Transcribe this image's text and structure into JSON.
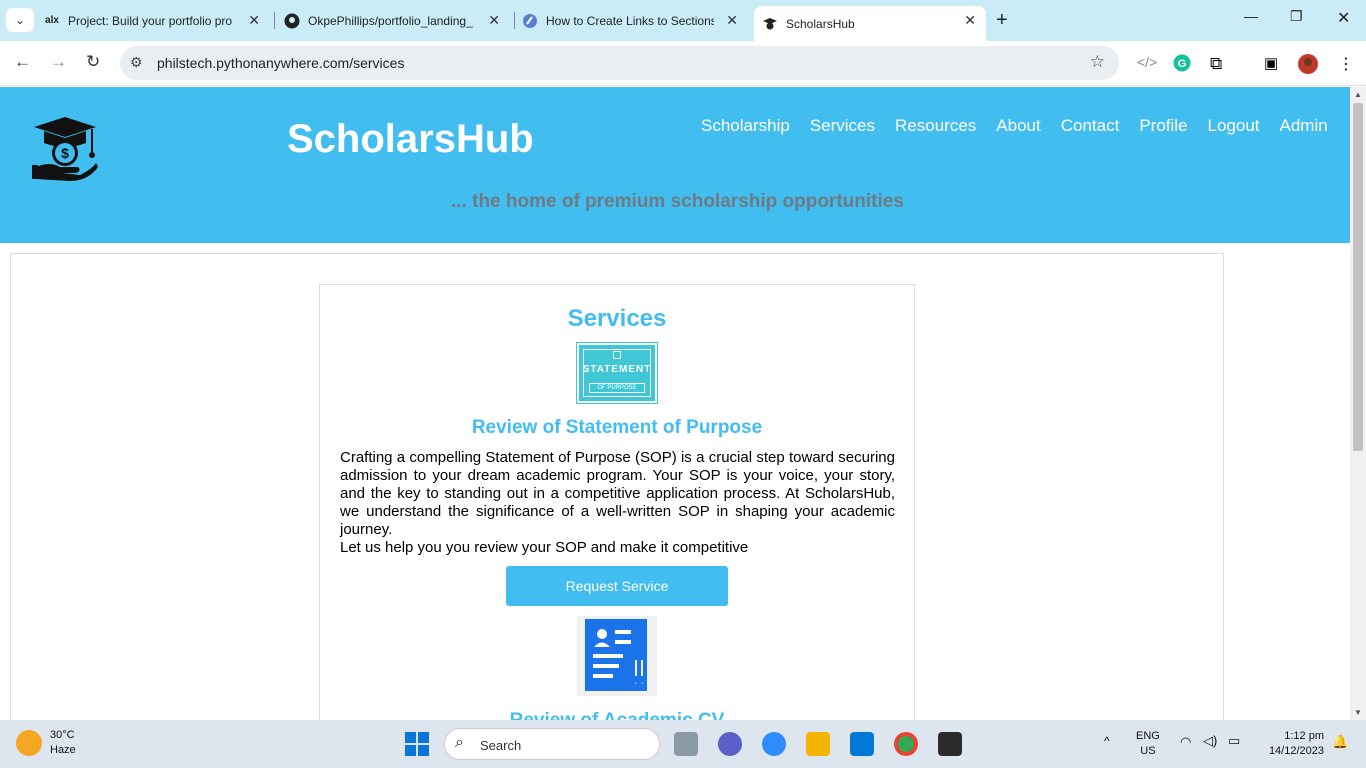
{
  "browser": {
    "tabs": [
      {
        "favicon": "alx",
        "title": "Project: Build your portfolio pro"
      },
      {
        "favicon": "github-icon",
        "title": "OkpePhillips/portfolio_landing_"
      },
      {
        "favicon": "globe-icon",
        "title": "How to Create Links to Sections"
      },
      {
        "favicon": "scholarshub-icon",
        "title": "ScholarsHub"
      }
    ],
    "url": "philstech.pythonanywhere.com/services"
  },
  "header": {
    "brand": "ScholarsHub",
    "tagline": "... the home of premium scholarship opportunities",
    "nav": [
      "Scholarship",
      "Services",
      "Resources",
      "About",
      "Contact",
      "Profile",
      "Logout",
      "Admin"
    ]
  },
  "services": {
    "heading": "Services",
    "items": [
      {
        "image_text_1": "STATEMENT",
        "image_text_2": "OF PURPOSE",
        "title": "Review of Statement of Purpose",
        "description": "Crafting a compelling Statement of Purpose (SOP) is a crucial step toward securing admission to your dream academic program. Your SOP is your voice, your story, and the key to standing out in a competitive application process. At ScholarsHub, we understand the significance of a well-written SOP in shaping your academic journey.",
        "cta_text": "Let us help you you review your SOP and make it competitive",
        "button": "Request Service"
      },
      {
        "title": "Review of Academic CV"
      }
    ]
  },
  "taskbar": {
    "weather_temp": "30°C",
    "weather_desc": "Haze",
    "search_placeholder": "Search",
    "lang_1": "ENG",
    "lang_2": "US",
    "time": "1:12 pm",
    "date": "14/12/2023"
  },
  "colors": {
    "header_bg": "#41bdf0",
    "accent": "#41bdf0",
    "tagline": "#6e7b84"
  }
}
